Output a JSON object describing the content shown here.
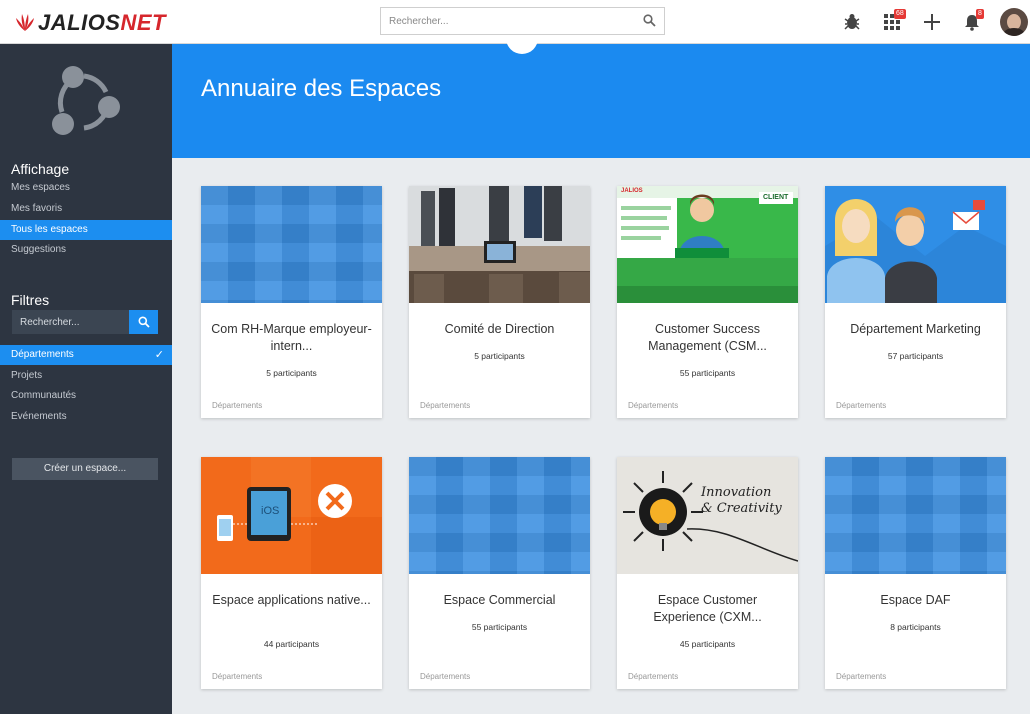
{
  "brand": {
    "prefix": "J",
    "name": "ALIOS",
    "suffix": "NET"
  },
  "search": {
    "placeholder": "Rechercher..."
  },
  "topbar": {
    "apps_badge": "68",
    "notif_badge": "8"
  },
  "sidebar": {
    "affichage_title": "Affichage",
    "affichage_items": [
      "Mes espaces",
      "Mes favoris",
      "Tous les espaces",
      "Suggestions"
    ],
    "filtres_title": "Filtres",
    "search_placeholder": "Rechercher...",
    "filter_items": [
      "Départements",
      "Projets",
      "Communautés",
      "Evénements"
    ],
    "create_label": "Créer un espace..."
  },
  "page": {
    "title": "Annuaire des Espaces"
  },
  "cards": [
    {
      "title": "Com RH-Marque employeur-intern...",
      "count": "5 participants",
      "category": "Départements"
    },
    {
      "title": "Comité de Direction",
      "count": "5 participants",
      "category": "Départements"
    },
    {
      "title": "Customer Success Management (CSM...",
      "count": "55 participants",
      "category": "Départements"
    },
    {
      "title": "Département Marketing",
      "count": "57 participants",
      "category": "Départements"
    },
    {
      "title": "Espace applications native...",
      "count": "44 participants",
      "category": "Départements"
    },
    {
      "title": "Espace Commercial",
      "count": "55 participants",
      "category": "Départements"
    },
    {
      "title": "Espace Customer Experience (CXM...",
      "count": "45 participants",
      "category": "Départements"
    },
    {
      "title": "Espace DAF",
      "count": "8 participants",
      "category": "Départements"
    }
  ],
  "images": {
    "green_client": "CLIENT",
    "green_brand": "JALIOS",
    "innov_line1": "Innovation",
    "innov_line2": "& Creativity",
    "ios_label": "iOS"
  },
  "colors": {
    "accent": "#1c8ef0",
    "sidebar": "#2d3541",
    "brand_red": "#d6262c"
  }
}
